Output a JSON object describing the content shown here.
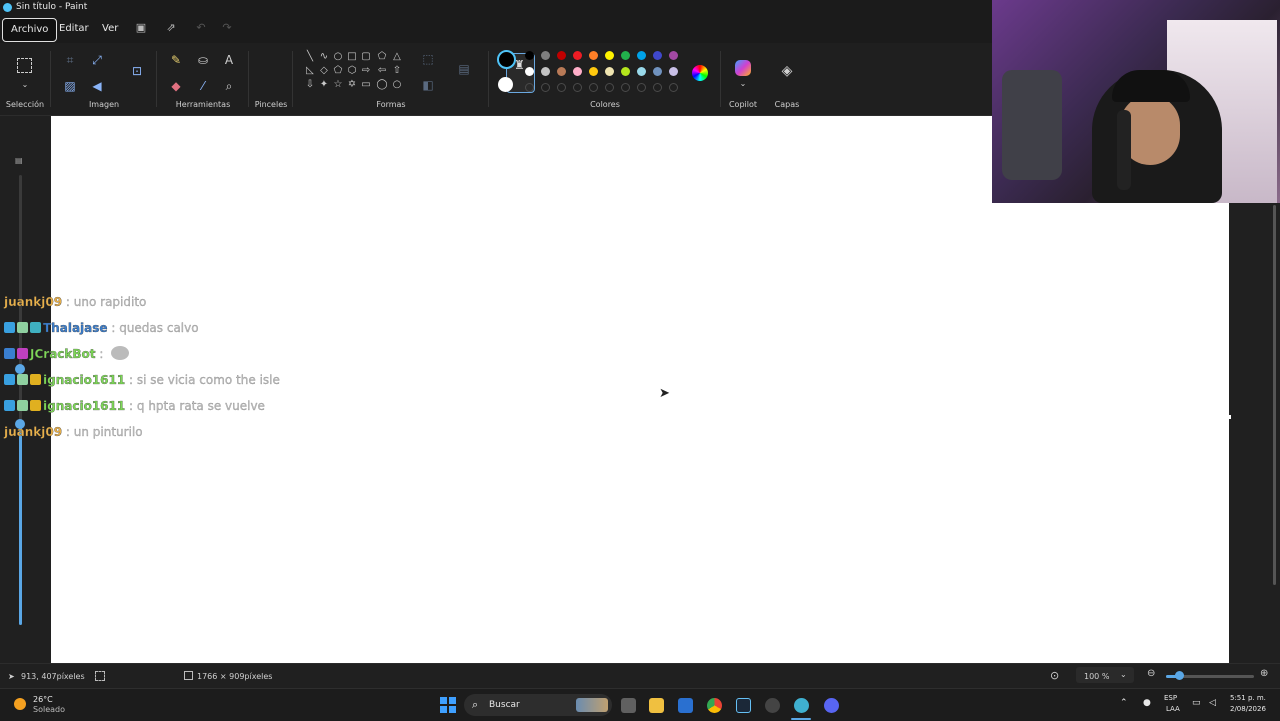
{
  "window": {
    "title": "Sin título - Paint"
  },
  "menu": {
    "archivo": "Archivo",
    "editar": "Editar",
    "ver": "Ver"
  },
  "ribbon": {
    "groups": {
      "seleccion": "Selección",
      "imagen": "Imagen",
      "herramientas": "Herramientas",
      "pinceles": "Pinceles",
      "formas": "Formas",
      "colores": "Colores",
      "copilot": "Copilot",
      "capas": "Capas"
    },
    "text_tool_glyph": "A",
    "primary_color": "#000000",
    "secondary_color": "#ffffff",
    "palette_row1": [
      "#000000",
      "#7f7f7f",
      "#c00000",
      "#ed1c24",
      "#ff7f27",
      "#fff200",
      "#22b14c",
      "#00a2e8",
      "#3f48cc",
      "#a349a4"
    ],
    "palette_row2": [
      "#ffffff",
      "#c3c3c3",
      "#b97a57",
      "#ffaec9",
      "#ffc90e",
      "#efe4b0",
      "#b5e61d",
      "#99d9ea",
      "#7092be",
      "#c8bfe7"
    ]
  },
  "chat": [
    {
      "user": "juankj09",
      "msg": ": uno rapidito",
      "color": "#e8b04a",
      "badges": []
    },
    {
      "user": "Thalajase",
      "msg": ": quedas calvo",
      "color": "#3a7fd0",
      "badges": [
        "#39a0e0",
        "#8fd0a0",
        "#3fb0c0"
      ]
    },
    {
      "user": "JCrackBot",
      "msg": ":",
      "color": "#7ed957",
      "badges": [
        "#3a7fd0",
        "#c040c0"
      ]
    },
    {
      "user": "ignacio1611",
      "msg": ": si se vicia como the isle",
      "color": "#7ed957",
      "badges": [
        "#39a0e0",
        "#8fd0a0",
        "#e0b020"
      ]
    },
    {
      "user": "ignacio1611",
      "msg": ": q hpta rata se vuelve",
      "color": "#7ed957",
      "badges": [
        "#39a0e0",
        "#8fd0a0",
        "#e0b020"
      ]
    },
    {
      "user": "juankj09",
      "msg": ": un pinturilo",
      "color": "#e8b04a",
      "badges": []
    }
  ],
  "status": {
    "cursor_position": "913, 407píxeles",
    "canvas_size": "1766 × 909píxeles",
    "zoom": "100 %"
  },
  "taskbar": {
    "temperature": "26°C",
    "weather": "Soleado",
    "search_placeholder": "Buscar",
    "language": "ESP",
    "layout": "LAA",
    "time": "5:51 p. m.",
    "date": "2/08/2026"
  }
}
